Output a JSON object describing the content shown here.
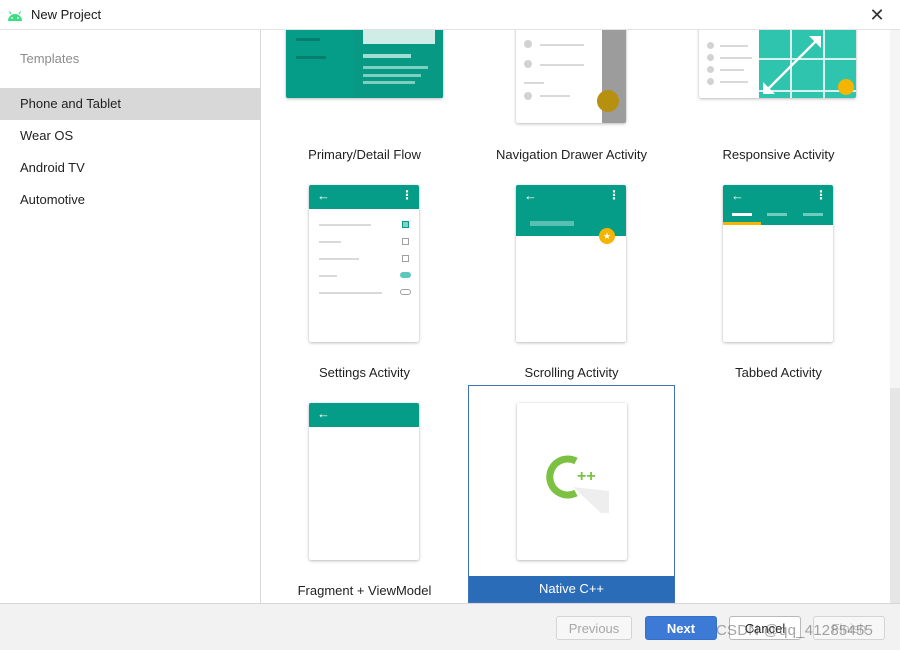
{
  "window": {
    "title": "New Project",
    "close_glyph": "✕"
  },
  "sidebar": {
    "heading": "Templates",
    "items": [
      {
        "label": "Phone and Tablet",
        "selected": true
      },
      {
        "label": "Wear OS",
        "selected": false
      },
      {
        "label": "Android TV",
        "selected": false
      },
      {
        "label": "Automotive",
        "selected": false
      }
    ]
  },
  "templates": [
    {
      "label": "Primary/Detail Flow"
    },
    {
      "label": "Navigation Drawer Activity"
    },
    {
      "label": "Responsive Activity"
    },
    {
      "label": "Settings Activity"
    },
    {
      "label": "Scrolling Activity"
    },
    {
      "label": "Tabbed Activity"
    },
    {
      "label": "Fragment + ViewModel"
    },
    {
      "label": "Native C++",
      "selected": true
    }
  ],
  "buttons": {
    "previous": "Previous",
    "next": "Next",
    "cancel": "Cancel",
    "finish": "Finish"
  },
  "watermark": "CSDN @qq_41285455",
  "colors": {
    "accent": "#069d88",
    "selection": "#2b6cb8",
    "primary_button": "#3d7ad6"
  }
}
